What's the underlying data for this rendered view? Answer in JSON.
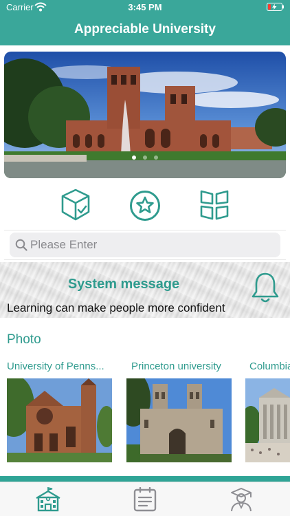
{
  "status_bar": {
    "carrier": "Carrier",
    "time": "3:45 PM"
  },
  "header": {
    "title": "Appreciable University"
  },
  "banner": {
    "page_count": 3,
    "active_page": 1
  },
  "quick_actions": [
    {
      "icon": "cube-check-icon"
    },
    {
      "icon": "star-circle-icon"
    },
    {
      "icon": "grid-panels-icon"
    }
  ],
  "search": {
    "placeholder": "Please Enter",
    "value": ""
  },
  "system_message": {
    "title": "System message",
    "text": "Learning can make people more confident",
    "icon": "bell-icon"
  },
  "photo": {
    "heading": "Photo",
    "items": [
      {
        "name": "University of Penns..."
      },
      {
        "name": "Princeton university"
      },
      {
        "name": "Columbia"
      }
    ]
  },
  "tabbar": [
    {
      "icon": "school-building-icon",
      "active": true
    },
    {
      "icon": "clipboard-icon",
      "active": false
    },
    {
      "icon": "graduate-icon",
      "active": false
    }
  ],
  "colors": {
    "accent": "#3aa79a",
    "accent_text": "#2f9b8e",
    "tab_inactive": "#8e8e93"
  }
}
